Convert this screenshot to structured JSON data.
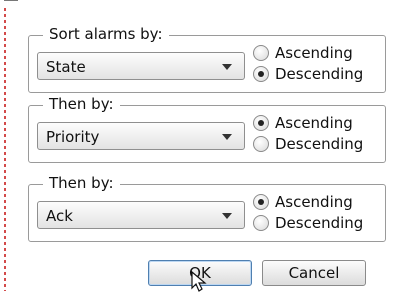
{
  "sort_groups": [
    {
      "legend": "Sort alarms by:",
      "selected": "State",
      "ascending_label": "Ascending",
      "descending_label": "Descending",
      "selected_order": "Descending"
    },
    {
      "legend": "Then by:",
      "selected": "Priority",
      "ascending_label": "Ascending",
      "descending_label": "Descending",
      "selected_order": "Ascending"
    },
    {
      "legend": "Then by:",
      "selected": "Ack",
      "ascending_label": "Ascending",
      "descending_label": "Descending",
      "selected_order": "Ascending"
    }
  ],
  "buttons": {
    "ok_label": "OK",
    "cancel_label": "Cancel"
  },
  "icons": {
    "combo_arrow": "chevron-down-icon",
    "cursor": "mouse-pointer-icon"
  },
  "colors": {
    "left_border": "#d34a4a",
    "ok_focus": "#4f7fb0"
  }
}
